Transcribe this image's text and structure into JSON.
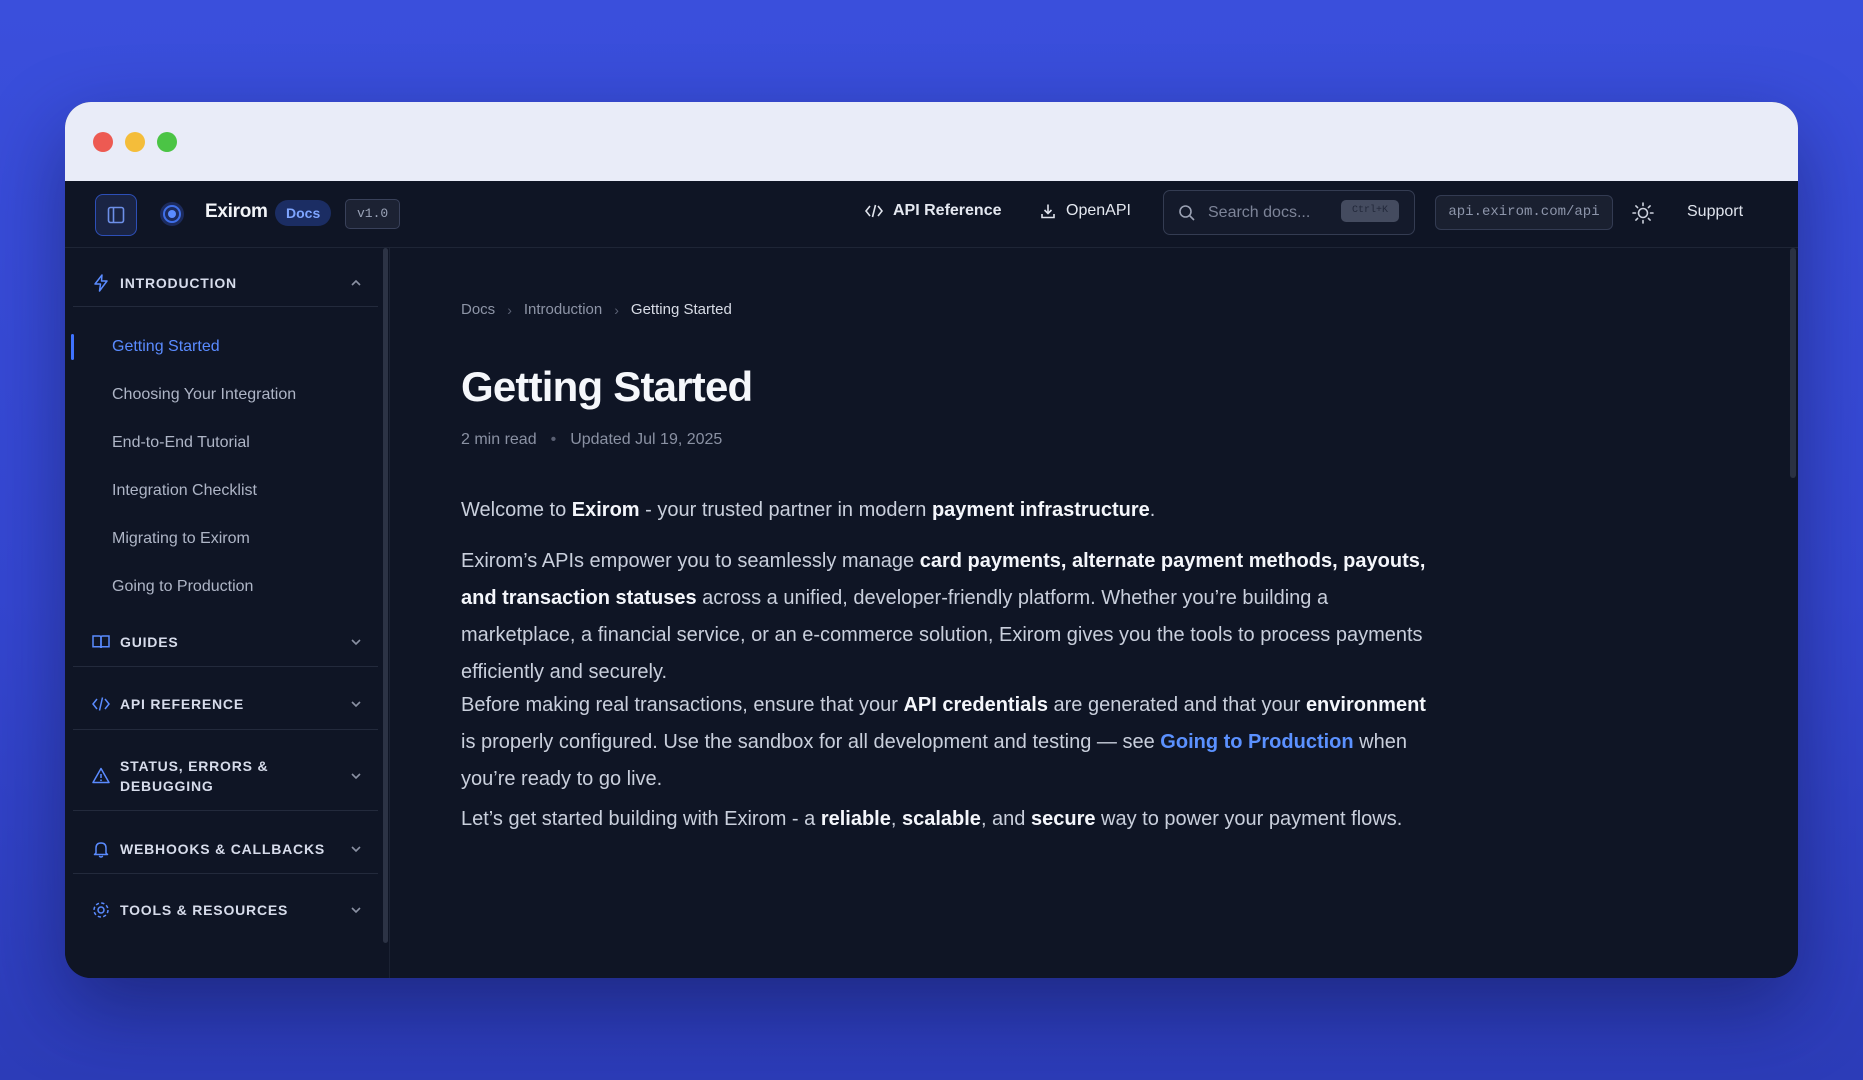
{
  "topbar": {
    "brand": "Exirom",
    "docs_badge": "Docs",
    "version": "v1.0",
    "nav_api_reference": "API Reference",
    "nav_openapi": "OpenAPI",
    "search_placeholder": "Search docs...",
    "search_shortcut": "Ctrl+K",
    "api_url": "api.exirom.com/api",
    "support": "Support"
  },
  "sidebar": {
    "sections": [
      {
        "label": "INTRODUCTION",
        "icon": "lightning-icon",
        "expanded": true
      },
      {
        "label": "GUIDES",
        "icon": "book-icon",
        "expanded": false
      },
      {
        "label": "API REFERENCE",
        "icon": "code-icon",
        "expanded": false
      },
      {
        "label": "STATUS, ERRORS &",
        "label2": "DEBUGGING",
        "icon": "warning-icon",
        "expanded": false
      },
      {
        "label": "WEBHOOKS & CALLBACKS",
        "icon": "bell-icon",
        "expanded": false
      },
      {
        "label": "TOOLS & RESOURCES",
        "icon": "gear-icon",
        "expanded": false
      }
    ],
    "intro_items": [
      {
        "label": "Getting Started",
        "active": true
      },
      {
        "label": "Choosing Your Integration"
      },
      {
        "label": "End-to-End Tutorial"
      },
      {
        "label": "Integration Checklist"
      },
      {
        "label": "Migrating to Exirom"
      },
      {
        "label": "Going to Production"
      }
    ]
  },
  "breadcrumb": [
    "Docs",
    "Introduction",
    "Getting Started"
  ],
  "page": {
    "title": "Getting Started",
    "read_time": "2 min read",
    "updated": "Updated Jul 19, 2025"
  },
  "content": {
    "p1": {
      "a": "Welcome to ",
      "b1": "Exirom",
      "c": " - your trusted partner in modern ",
      "b2": "payment infrastructure",
      "d": "."
    },
    "p2": {
      "a": "Exirom’s APIs empower you to seamlessly manage ",
      "b1": "card payments, alternate payment methods, payouts, and transaction statuses",
      "c": " across a unified, developer-friendly platform. Whether you’re building a marketplace, a financial service, or an e-commerce solution, Exirom gives you the tools to process payments efficiently and securely."
    },
    "p3": {
      "a": "Before making real transactions, ensure that your ",
      "b1": "API credentials",
      "c": " are generated and that your ",
      "b2": "environment",
      "d": " is properly configured. Use the sandbox for all development and testing — see ",
      "link": "Going to Production",
      "e": " when you’re ready to go live."
    },
    "p4": {
      "a": "Let’s get started building with Exirom - a ",
      "b1": "reliable",
      "c": ", ",
      "b2": "scalable",
      "d": ", and ",
      "b3": "secure",
      "e": " way to power your payment flows."
    }
  },
  "colors": {
    "accent": "#3f73ff",
    "link": "#5b91ff",
    "background": "#0f1525",
    "desktop": "#3a4fdc"
  }
}
